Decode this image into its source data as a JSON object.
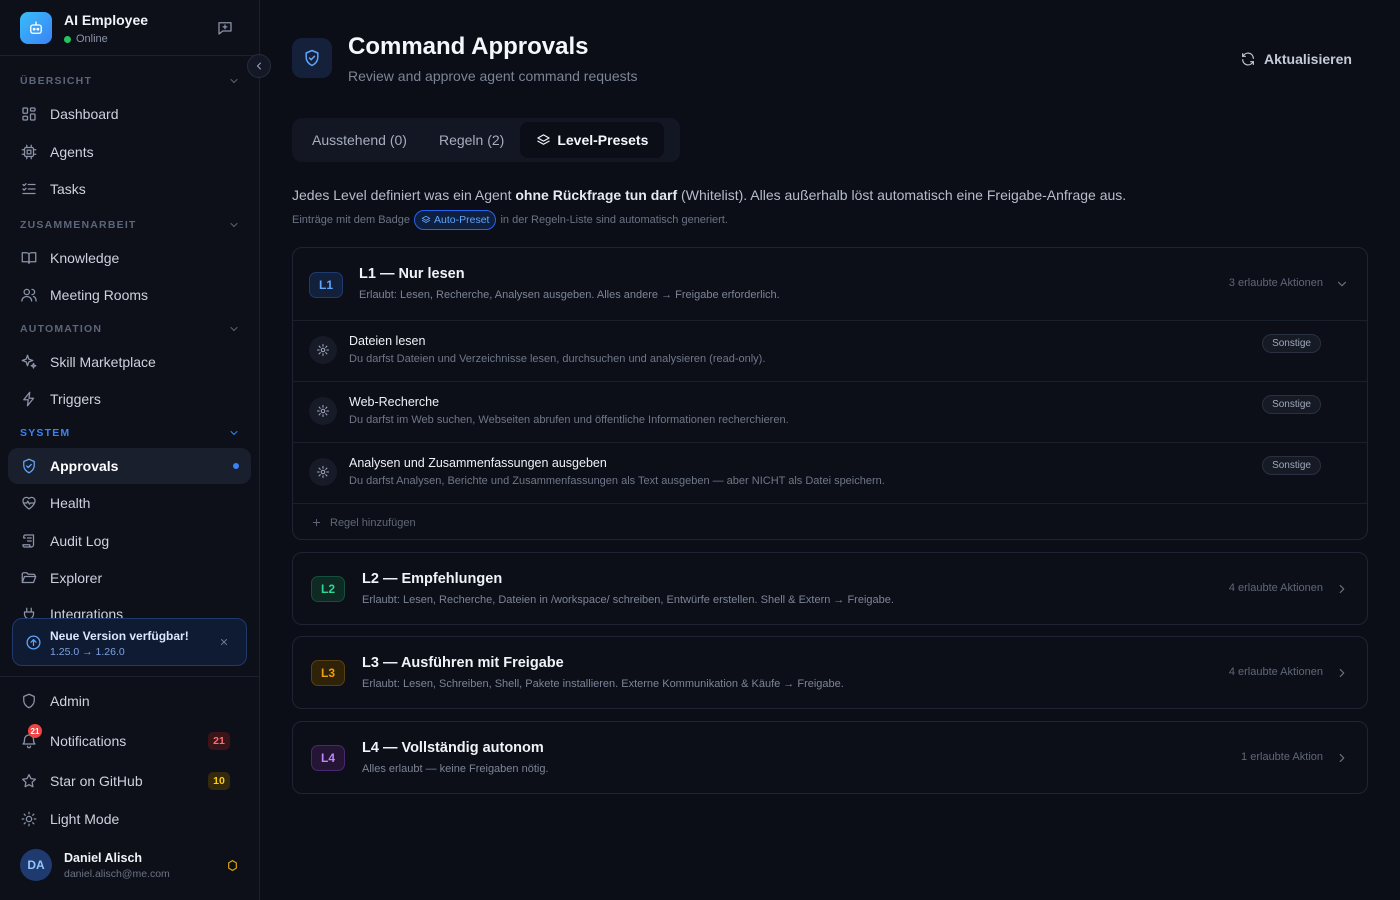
{
  "app": {
    "name": "AI Employee",
    "status": "Online"
  },
  "sidebar": {
    "sections": {
      "overview": "ÜBERSICHT",
      "collab": "ZUSAMMENARBEIT",
      "automation": "AUTOMATION",
      "system": "SYSTEM"
    },
    "items": {
      "dashboard": "Dashboard",
      "agents": "Agents",
      "tasks": "Tasks",
      "knowledge": "Knowledge",
      "meeting_rooms": "Meeting Rooms",
      "skill_marketplace": "Skill Marketplace",
      "triggers": "Triggers",
      "approvals": "Approvals",
      "health": "Health",
      "audit_log": "Audit Log",
      "explorer": "Explorer",
      "integrations": "Integrations"
    },
    "update": {
      "title": "Neue Version verfügbar!",
      "versions": "1.25.0 → 1.26.0"
    },
    "bottom": {
      "admin": "Admin",
      "notifications": "Notifications",
      "notifications_count": "21",
      "github": "Star on GitHub",
      "github_count": "10",
      "theme": "Light Mode"
    },
    "user": {
      "initials": "DA",
      "name": "Daniel Alisch",
      "email": "daniel.alisch@me.com"
    }
  },
  "header": {
    "title": "Command Approvals",
    "subtitle": "Review and approve agent command requests",
    "refresh": "Aktualisieren"
  },
  "tabs": {
    "pending": "Ausstehend (0)",
    "rules": "Regeln (2)",
    "presets": "Level-Presets"
  },
  "intro": {
    "part1": "Jedes Level definiert was ein Agent ",
    "bold": "ohne Rückfrage tun darf",
    "part2": " (Whitelist). Alles außerhalb löst automatisch eine Freigabe-Anfrage aus.",
    "hint_before": "Einträge mit dem Badge",
    "badge": "Auto-Preset",
    "hint_after": "in der Regeln-Liste sind automatisch generiert."
  },
  "levels": [
    {
      "badge": "L1",
      "title": "L1 — Nur lesen",
      "desc": "Erlaubt: Lesen, Recherche, Analysen ausgeben. Alles andere → Freigabe erforderlich.",
      "count": "3 erlaubte Aktionen",
      "color": "#60a5fa",
      "rules": [
        {
          "title": "Dateien lesen",
          "desc": "Du darfst Dateien und Verzeichnisse lesen, durchsuchen und analysieren (read-only).",
          "tag": "Sonstige"
        },
        {
          "title": "Web-Recherche",
          "desc": "Du darfst im Web suchen, Webseiten abrufen und öffentliche Informationen recherchieren.",
          "tag": "Sonstige"
        },
        {
          "title": "Analysen und Zusammenfassungen ausgeben",
          "desc": "Du darfst Analysen, Berichte und Zusammenfassungen als Text ausgeben — aber NICHT als Datei speichern.",
          "tag": "Sonstige"
        }
      ],
      "add_rule": "Regel hinzufügen"
    },
    {
      "badge": "L2",
      "title": "L2 — Empfehlungen",
      "desc": "Erlaubt: Lesen, Recherche, Dateien in /workspace/ schreiben, Entwürfe erstellen. Shell & Extern → Freigabe.",
      "count": "4 erlaubte Aktionen",
      "color": "#34d399"
    },
    {
      "badge": "L3",
      "title": "L3 — Ausführen mit Freigabe",
      "desc": "Erlaubt: Lesen, Schreiben, Shell, Pakete installieren. Externe Kommunikation & Käufe → Freigabe.",
      "count": "4 erlaubte Aktionen",
      "color": "#f59e0b"
    },
    {
      "badge": "L4",
      "title": "L4 — Vollständig autonom",
      "desc": "Alles erlaubt — keine Freigaben nötig.",
      "count": "1 erlaubte Aktion",
      "color": "#c084fc"
    }
  ]
}
